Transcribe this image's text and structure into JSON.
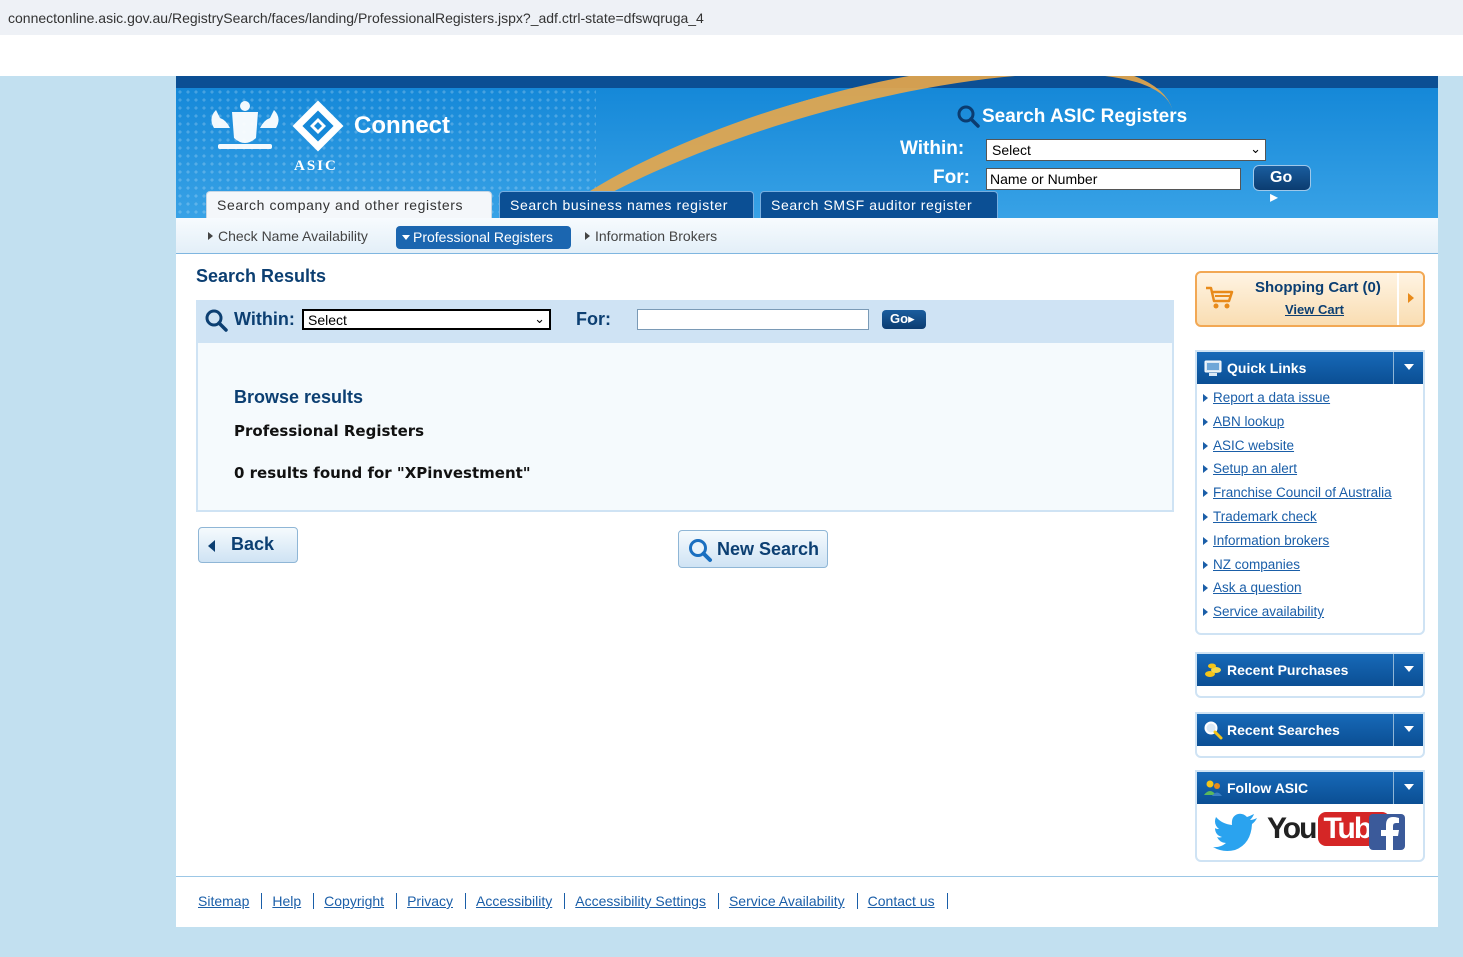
{
  "browser": {
    "url": "connectonline.asic.gov.au/RegistrySearch/faces/landing/ProfessionalRegisters.jspx?_adf.ctrl-state=dfswqruga_4"
  },
  "header": {
    "brand": "Connect",
    "asic_label": "ASIC",
    "search_title": "Search ASIC Registers",
    "within_label": "Within:",
    "within_value": "Select",
    "for_label": "For:",
    "for_placeholder": "Name or Number",
    "go_label": "Go"
  },
  "tabs": [
    {
      "label": "Search company and other registers",
      "active": true
    },
    {
      "label": "Search business names register",
      "active": false
    },
    {
      "label": "Search SMSF auditor register",
      "active": false
    }
  ],
  "subnav": [
    {
      "label": "Check Name Availability",
      "active": false
    },
    {
      "label": "Professional Registers",
      "active": true
    },
    {
      "label": "Information Brokers",
      "active": false
    }
  ],
  "main": {
    "title": "Search Results",
    "within_label": "Within:",
    "within_value": "Select",
    "for_label": "For:",
    "for_value": "",
    "go_label": "Go",
    "browse_title": "Browse results",
    "browse_sub": "Professional Registers",
    "browse_count": "0 results found for \"XPinvestment\"",
    "back_label": "Back",
    "new_search_label": "New Search"
  },
  "sidebar": {
    "cart_title": "Shopping Cart (0)",
    "cart_link": "View Cart",
    "quick_links_title": "Quick Links",
    "quick_links": [
      "Report a data issue",
      "ABN lookup",
      "ASIC website",
      "Setup an alert",
      "Franchise Council of Australia",
      "Trademark check",
      "Information brokers",
      "NZ companies",
      "Ask a question",
      "Service availability"
    ],
    "recent_purchases_title": "Recent Purchases",
    "recent_searches_title": "Recent Searches",
    "follow_title": "Follow ASIC",
    "youtube_you": "You",
    "youtube_tube": "Tube"
  },
  "footer": [
    "Sitemap",
    "Help",
    "Copyright",
    "Privacy",
    "Accessibility",
    "Accessibility Settings",
    "Service Availability",
    "Contact us"
  ],
  "colors": {
    "brand_blue": "#0b4f94",
    "accent_orange": "#f2a854",
    "link_blue": "#1a5ea8"
  }
}
